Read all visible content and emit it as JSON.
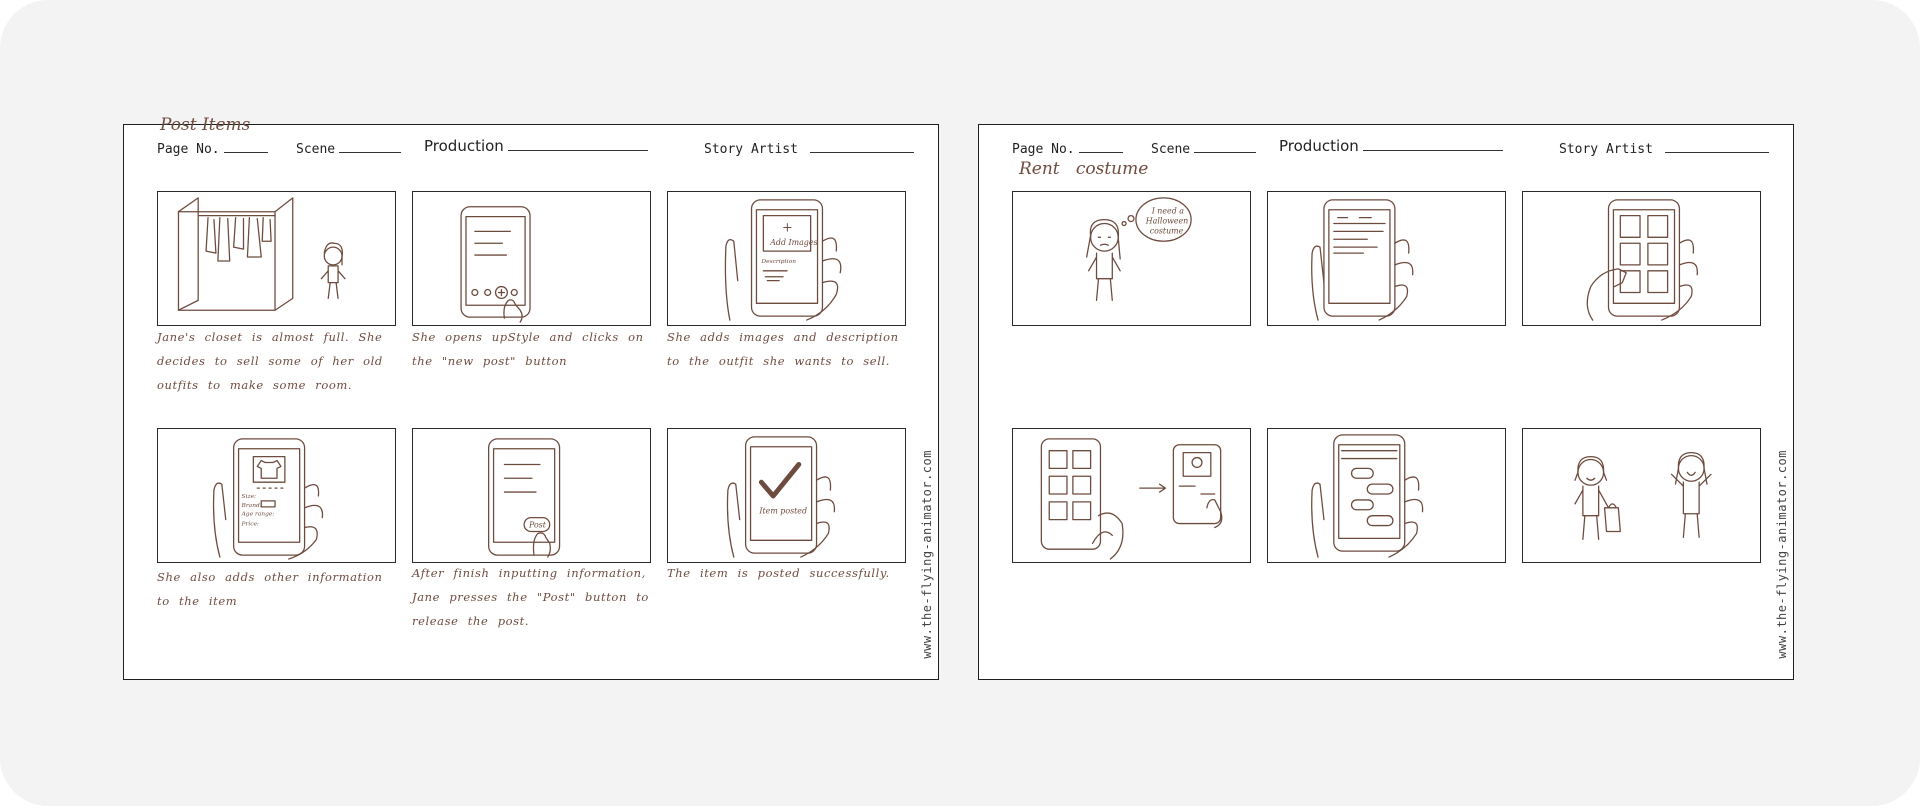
{
  "sheets": [
    {
      "title": "Post Items",
      "header": {
        "page": "Page No.",
        "scene": "Scene",
        "production": "Production",
        "artist": "Story Artist"
      },
      "watermark": "www.the-flying-animator.com",
      "panels": [
        {
          "caption": "Jane's closet is almost full. She decides to sell some of her old outfits to make some room."
        },
        {
          "caption": "She opens upStyle and clicks on the \"new post\" button"
        },
        {
          "caption": "She adds images and description to the outfit she wants to sell.",
          "labels": [
            "+",
            "Add Images",
            "Description"
          ]
        },
        {
          "caption": "She also adds other information to the item",
          "labels": [
            "Size:",
            "Brand:",
            "Age range:",
            "Price:"
          ]
        },
        {
          "caption": "After finish inputting information, Jane presses the \"Post\" button to release the post.",
          "labels": [
            "Post"
          ]
        },
        {
          "caption": "The item is posted successfully.",
          "labels": [
            "Item posted"
          ]
        }
      ]
    },
    {
      "title": "Rent   costume",
      "header": {
        "page": "Page No.",
        "scene": "Scene",
        "production": "Production",
        "artist": "Story Artist"
      },
      "watermark": "www.the-flying-animator.com",
      "panels": [
        {
          "labels": [
            "I need a",
            "Halloween",
            "costume"
          ]
        },
        {},
        {},
        {},
        {},
        {}
      ]
    }
  ],
  "colors": {
    "ink": "#6e4b3f",
    "frame": "#2a2a2a",
    "background": "#f3f3f3"
  }
}
